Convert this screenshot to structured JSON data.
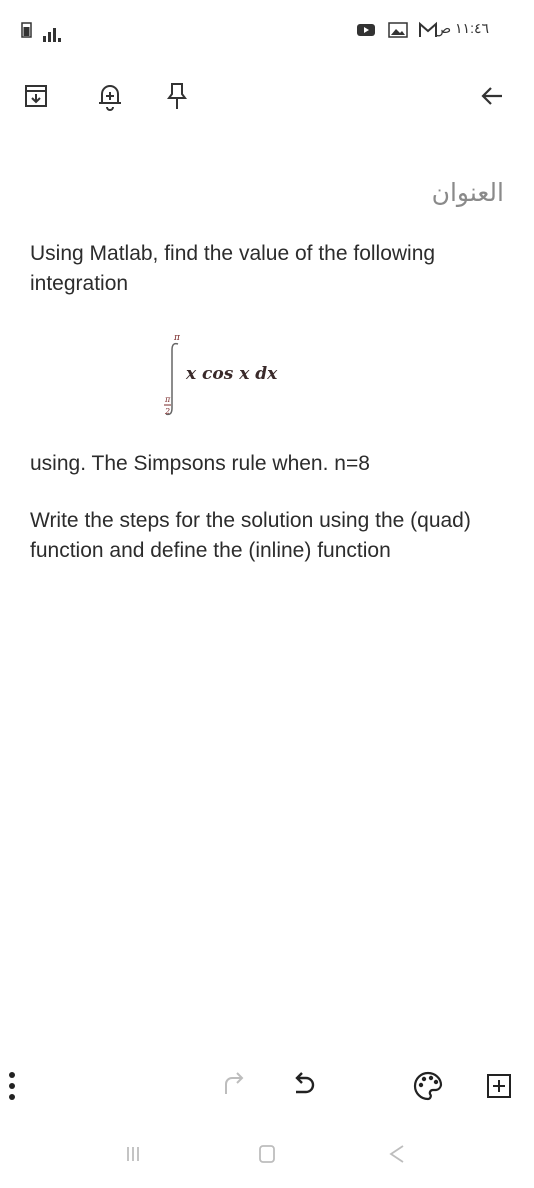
{
  "status_bar": {
    "time": "١١:٤٦ ص"
  },
  "toolbar": {
    "icons": [
      "archive-icon",
      "add-reminder-icon",
      "pin-icon",
      "back-arrow-icon"
    ]
  },
  "note": {
    "title_placeholder": "العنوان",
    "paragraph1": "Using Matlab, find the value of the following integration",
    "formula": {
      "upper_limit": "π",
      "lower_limit_num": "π",
      "lower_limit_den": "2",
      "integrand": "x cos x dx"
    },
    "paragraph2": "using.  The Simpsons rule when.  n=8",
    "paragraph3": "Write the steps for the solution using the (quad) function and define the (inline) function"
  },
  "bottom_toolbar": {
    "icons": [
      "more-icon",
      "redo-icon",
      "undo-icon",
      "palette-icon",
      "add-box-icon"
    ]
  },
  "nav_bar": {
    "icons": [
      "recent-apps-icon",
      "home-icon",
      "back-icon"
    ]
  }
}
